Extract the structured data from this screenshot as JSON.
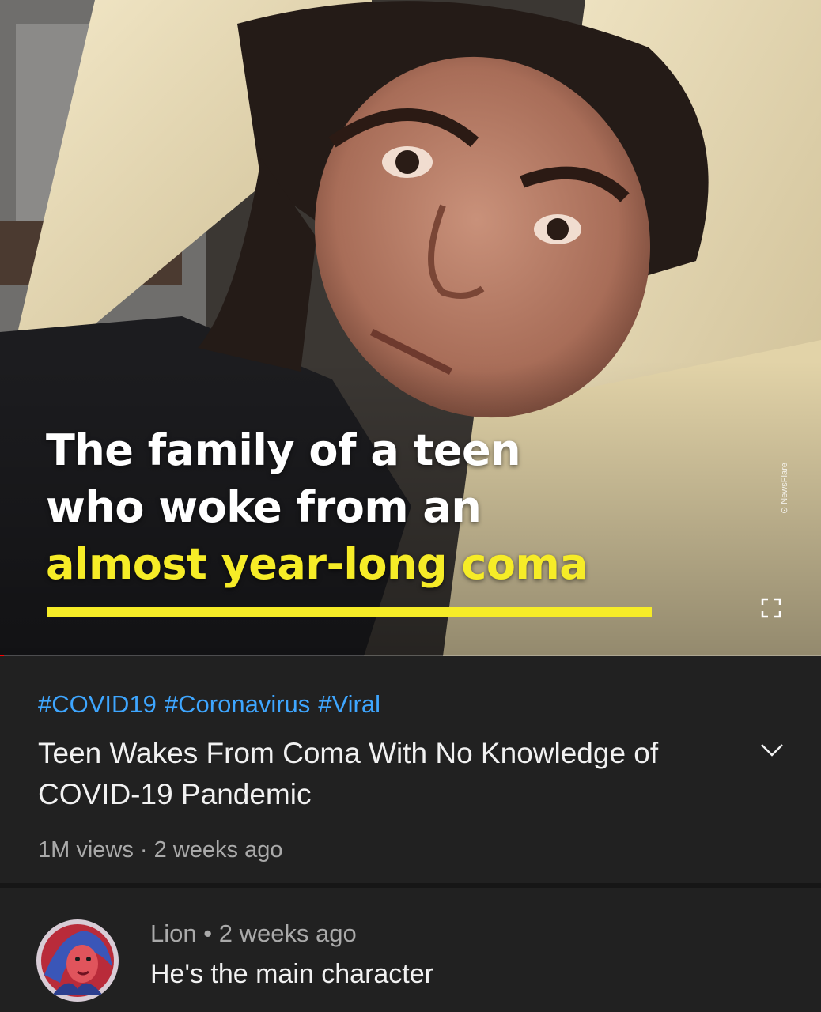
{
  "video": {
    "caption_line1": "The family of a teen",
    "caption_line2": "who woke from an",
    "caption_line3": "almost year-long coma",
    "watermark": "NewsFlare",
    "progress_fraction": 0.005,
    "progress_color": "#ff0000",
    "highlight_color": "#f6ec27"
  },
  "info": {
    "hashtags": [
      "#COVID19",
      "#Coronavirus",
      "#Viral"
    ],
    "title": "Teen Wakes From Coma With No Knowledge of COVID-19 Pandemic",
    "views": "1M views",
    "separator": "·",
    "age": "2 weeks ago",
    "hashtag_color": "#3ea6ff"
  },
  "comment": {
    "author": "Lion",
    "separator": "•",
    "age": "2 weeks ago",
    "text": "He's the main character"
  },
  "icons": {
    "fullscreen": "fullscreen-icon",
    "expand": "chevron-down-icon",
    "avatar": "avatar"
  }
}
